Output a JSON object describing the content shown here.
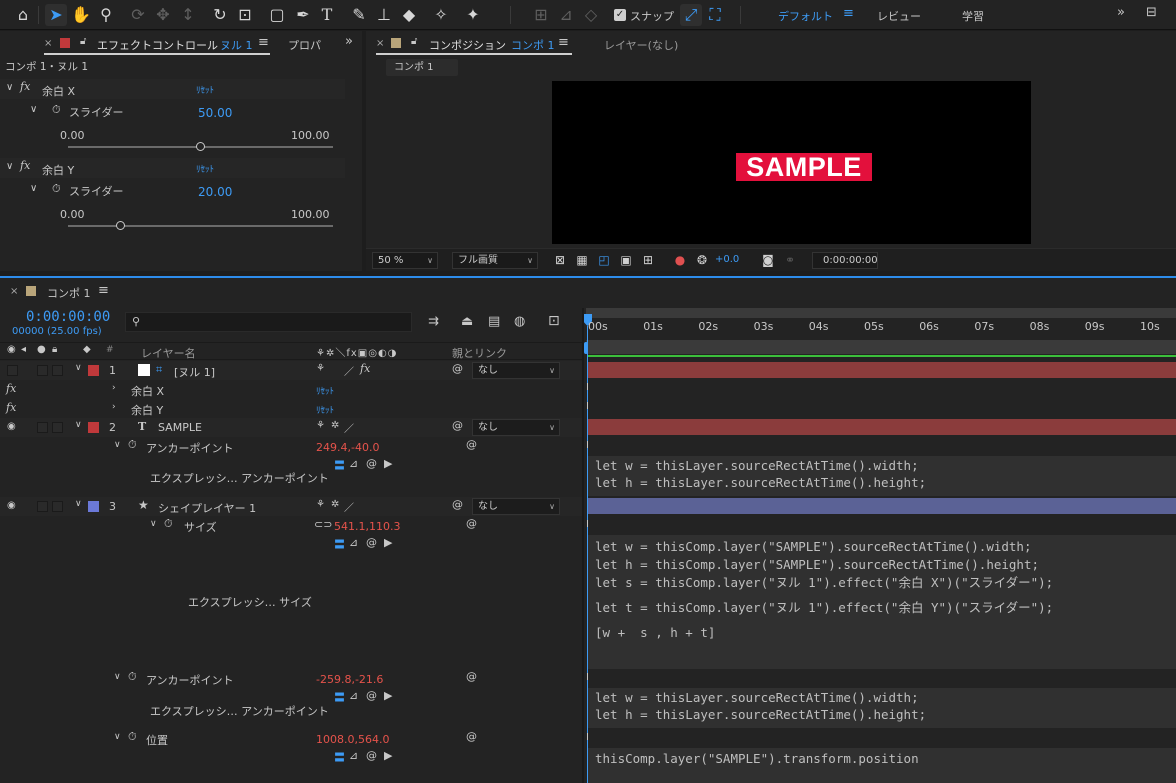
{
  "toolbar": {
    "tools": [
      "home-icon",
      "selection-tool-icon",
      "hand-tool-icon",
      "zoom-tool-icon",
      "orbit-camera-icon",
      "pan-camera-icon",
      "dolly-camera-icon",
      "rotation-tool-icon",
      "pan-behind-icon",
      "rectangle-tool-icon",
      "pen-tool-icon",
      "type-tool-icon",
      "brush-tool-icon",
      "clone-stamp-icon",
      "eraser-icon",
      "roto-brush-icon",
      "puppet-pin-icon"
    ],
    "snap_label": "スナップ",
    "workspaces": [
      "デフォルト",
      "レビュー",
      "学習"
    ]
  },
  "effect_panel": {
    "tab_label": "エフェクトコントロール",
    "tab_layer": "ヌル 1",
    "tab_other": "プロパ",
    "breadcrumb": "コンポ 1・ヌル 1",
    "effects": [
      {
        "name": "余白 X",
        "reset": "ﾘｾｯﾄ",
        "param": "スライダー",
        "value": "50.00",
        "min": "0.00",
        "max": "100.00",
        "fraction": 0.5
      },
      {
        "name": "余白 Y",
        "reset": "ﾘｾｯﾄ",
        "param": "スライダー",
        "value": "20.00",
        "min": "0.00",
        "max": "100.00",
        "fraction": 0.2
      }
    ]
  },
  "comp_panel": {
    "tab_label": "コンポジション",
    "tab_comp": "コンポ 1",
    "layer_tab": "レイヤー(なし)",
    "flow_tab": "コンポ 1",
    "sample_text": "SAMPLE",
    "zoom": "50 %",
    "resolution": "フル画質",
    "exposure": "+0.0",
    "timecode": "0:00:00:00"
  },
  "timeline": {
    "tab_label": "コンポ 1",
    "timecode": "0:00:00:00",
    "frame_info": "00000 (25.00 fps)",
    "search_placeholder": "",
    "col_layer_name": "レイヤー名",
    "col_parent": "親とリンク",
    "ruler": [
      "00s",
      "01s",
      "02s",
      "03s",
      "04s",
      "05s",
      "06s",
      "07s",
      "08s",
      "09s",
      "10s"
    ],
    "layers": [
      {
        "num": "1",
        "name": "[ヌル 1]",
        "parent": "なし",
        "color": "#c0393b",
        "bar": "#8b3c3c"
      },
      {
        "num": "2",
        "name": "SAMPLE",
        "parent": "なし",
        "color": "#c0393b",
        "bar": "#8b3c3c"
      },
      {
        "num": "3",
        "name": "シェイプレイヤー 1",
        "parent": "なし",
        "color": "#6b79d8",
        "bar": "#5b6296"
      }
    ],
    "effects_rows": [
      {
        "name": "余白 X",
        "reset": "ﾘｾｯﾄ"
      },
      {
        "name": "余白 Y",
        "reset": "ﾘｾｯﾄ"
      }
    ],
    "props": {
      "sample_anchor": {
        "label": "アンカーポイント",
        "value": "249.4,-40.0",
        "expr_label": "エクスプレッシ… アンカーポイント"
      },
      "shape_size": {
        "label": "サイズ",
        "value": "541.1,110.3",
        "expr_label": "エクスプレッシ… サイズ"
      },
      "shape_anchor": {
        "label": "アンカーポイント",
        "value": "-259.8,-21.6",
        "expr_label": "エクスプレッシ… アンカーポイント"
      },
      "shape_position": {
        "label": "位置",
        "value": "1008.0,564.0"
      }
    },
    "expressions": {
      "sample_anchor": [
        "let w = thisLayer.sourceRectAtTime().width;",
        "let h = thisLayer.sourceRectAtTime().height;"
      ],
      "shape_size": [
        "let w = thisComp.layer(\"SAMPLE\").sourceRectAtTime().width;",
        "let h = thisComp.layer(\"SAMPLE\").sourceRectAtTime().height;",
        "let s = thisComp.layer(\"ヌル 1\").effect(\"余白 X\")(\"スライダー\");",
        "let t = thisComp.layer(\"ヌル 1\").effect(\"余白 Y\")(\"スライダー\");",
        "[w +  s , h + t]"
      ],
      "shape_anchor": [
        "let w = thisLayer.sourceRectAtTime().width;",
        "let h = thisLayer.sourceRectAtTime().height;"
      ],
      "shape_position": [
        "thisComp.layer(\"SAMPLE\").transform.position"
      ]
    }
  }
}
